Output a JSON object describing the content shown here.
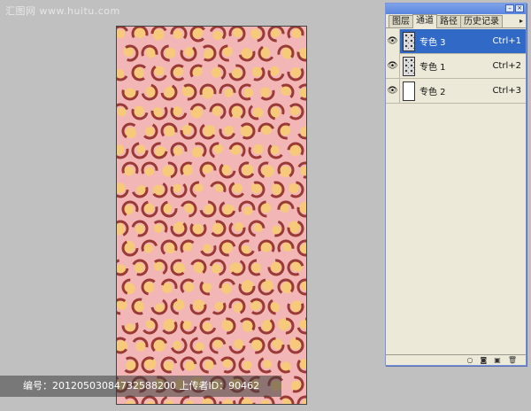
{
  "watermark_top": "汇图网 www.huitu.com",
  "watermark_bottom": "编号：20120503084732588200 上传者ID：90462",
  "canvas": {
    "background_color": "#f2b6b6",
    "ring_color": "#9a3a36",
    "fill_color": "#f7c97a"
  },
  "panel": {
    "tabs": [
      "图层",
      "通道",
      "路径",
      "历史记录"
    ],
    "active_tab": 1,
    "menu_arrow": "▸",
    "minimize_glyph": "–",
    "close_glyph": "×",
    "channels": [
      {
        "name": "专色 3",
        "shortcut": "Ctrl+1",
        "selected": true,
        "thumb": "pattern"
      },
      {
        "name": "专色 1",
        "shortcut": "Ctrl+2",
        "selected": false,
        "thumb": "pattern"
      },
      {
        "name": "专色 2",
        "shortcut": "Ctrl+3",
        "selected": false,
        "thumb": "blank"
      }
    ],
    "bottom_icons": [
      "load-selection-icon",
      "save-selection-icon",
      "new-channel-icon",
      "delete-channel-icon"
    ]
  }
}
